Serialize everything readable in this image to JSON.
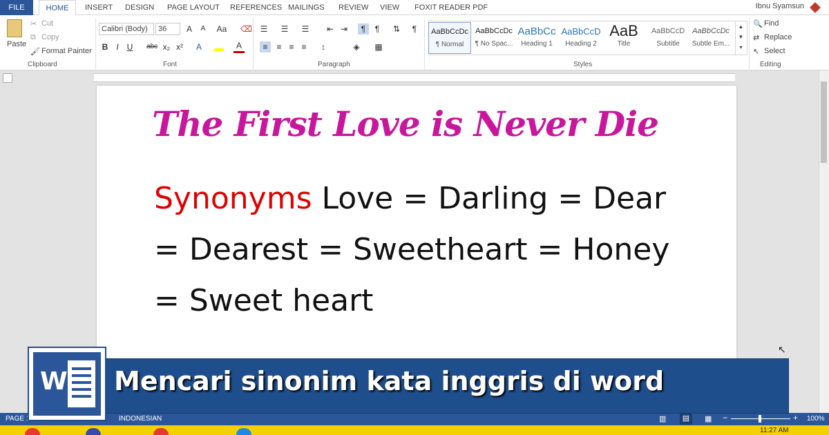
{
  "tabs": {
    "file": "FILE",
    "items": [
      "HOME",
      "INSERT",
      "DESIGN",
      "PAGE LAYOUT",
      "REFERENCES",
      "MAILINGS",
      "REVIEW",
      "VIEW",
      "FOXIT READER PDF"
    ]
  },
  "user": "Ibnu Syamsun",
  "clipboard": {
    "paste": "Paste",
    "cut": "Cut",
    "copy": "Copy",
    "format_painter": "Format Painter",
    "label": "Clipboard"
  },
  "font": {
    "family": "Calibri (Body)",
    "size": "36",
    "label": "Font",
    "grow": "A",
    "shrink": "A",
    "case": "Aa",
    "bold": "B",
    "italic": "I",
    "underline": "U",
    "strike": "abc",
    "sub": "x₂",
    "sup": "x²"
  },
  "paragraph": {
    "label": "Paragraph",
    "pilcrow": "¶"
  },
  "styles": {
    "label": "Styles",
    "items": [
      {
        "sample": "AaBbCcDc",
        "name": "¶ Normal"
      },
      {
        "sample": "AaBbCcDc",
        "name": "¶ No Spac..."
      },
      {
        "sample": "AaBbCc",
        "name": "Heading 1"
      },
      {
        "sample": "AaBbCcD",
        "name": "Heading 2"
      },
      {
        "sample": "AaB",
        "name": "Title"
      },
      {
        "sample": "AaBbCcD",
        "name": "Subtitle"
      },
      {
        "sample": "AaBbCcDc",
        "name": "Subtle Em..."
      }
    ]
  },
  "editing": {
    "find": "Find",
    "replace": "Replace",
    "select": "Select",
    "label": "Editing"
  },
  "document": {
    "title": "The First Love is Never Die",
    "synonyms_word": "Synonyms",
    "line1_rest": " Love = Darling = Dear",
    "line2": "= Dearest = Sweetheart = Honey",
    "line3": "= Sweet heart"
  },
  "banner": {
    "text": "Mencari sinonim kata inggris di word",
    "logo_letter": "W"
  },
  "status": {
    "page": "PAGE 1",
    "language": "INDONESIAN",
    "zoom": "100%",
    "zoom_minus": "−",
    "zoom_plus": "+"
  },
  "taskbar": {
    "time": "11:27 AM"
  },
  "colors": {
    "accent": "#2b579a",
    "title": "#c8179d",
    "synonyms": "#e00000",
    "banner": "#1f4e8c",
    "taskbar": "#f5d000"
  }
}
